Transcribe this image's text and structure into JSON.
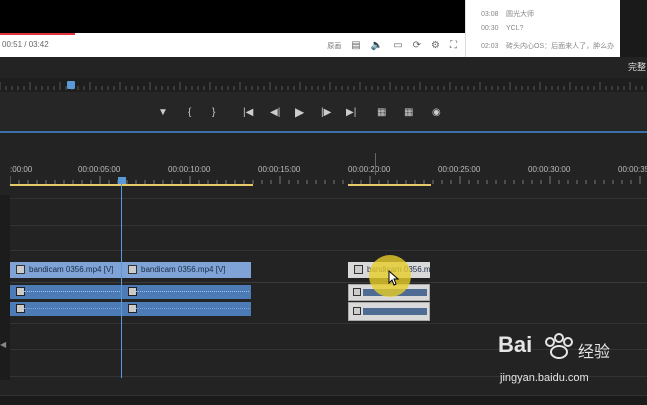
{
  "player": {
    "time": "00:51 / 03:42",
    "quality_label": "原画",
    "icons": [
      "danmaku-icon",
      "volume-icon",
      "subtitle-icon",
      "loop-icon",
      "settings-icon",
      "fullscreen-icon"
    ]
  },
  "comments": [
    {
      "time": "03:08",
      "text": "圆光大师"
    },
    {
      "time": "00:30",
      "text": "YCL?"
    },
    {
      "time": "02:03",
      "text": "砖头内心OS：后面来人了，肿么办"
    }
  ],
  "edge_label": "完整",
  "transport": {
    "buttons": [
      "marker-icon",
      "in-point-icon",
      "out-point-icon",
      "go-to-in-icon",
      "step-back-icon",
      "play-icon",
      "step-forward-icon",
      "go-to-out-icon",
      "lift-icon",
      "extract-icon",
      "export-frame-icon"
    ]
  },
  "timeline": {
    "timecodes": [
      ":00:00",
      "00:00:05:00",
      "00:00:10:00",
      "00:00:15:00",
      "00:00:20:00",
      "00:00:25:00",
      "00:00:30:00",
      "00:00:35"
    ],
    "clips": [
      {
        "label": "bandicam 0356.mp4 [V]"
      },
      {
        "label": "bandicam 0356.mp4 [V]"
      },
      {
        "label": "bandicam 0356.m"
      }
    ]
  },
  "watermark": {
    "brand": "Bai",
    "brand_suffix": "经验",
    "url": "jingyan.baidu.com"
  },
  "colors": {
    "accent": "#5a9ad8",
    "clip_video": "#7fa3d6",
    "clip_audio": "#4d7bb5",
    "in_out": "#e8c96a"
  }
}
